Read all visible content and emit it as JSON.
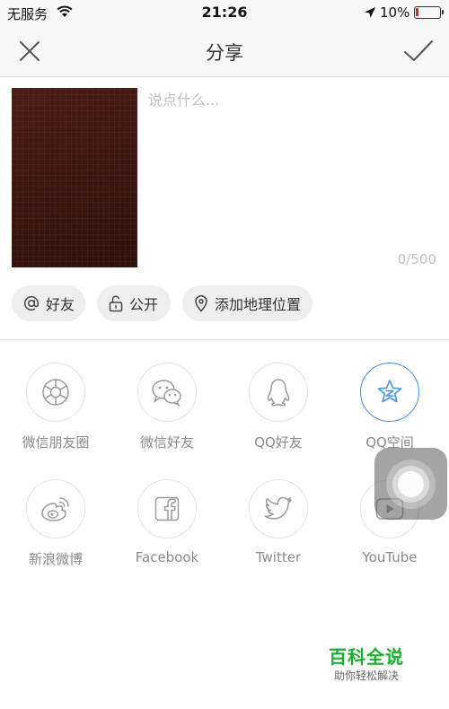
{
  "status_bar": {
    "carrier": "无服务",
    "time": "21:26",
    "battery_percent": "10%",
    "battery_level": 0.1,
    "battery_color": "#e02020"
  },
  "nav": {
    "title": "分享",
    "close_icon": "close-icon",
    "confirm_icon": "checkmark-icon"
  },
  "compose": {
    "placeholder": "说点什么...",
    "counter": "0/500"
  },
  "chips": [
    {
      "label": "好友",
      "icon": "at-icon"
    },
    {
      "label": "公开",
      "icon": "unlock-icon"
    },
    {
      "label": "添加地理位置",
      "icon": "location-pin-icon"
    }
  ],
  "share_targets": [
    {
      "label": "微信朋友圈",
      "icon": "wechat-moments-icon"
    },
    {
      "label": "微信好友",
      "icon": "wechat-icon"
    },
    {
      "label": "QQ好友",
      "icon": "qq-icon"
    },
    {
      "label": "QQ空间",
      "icon": "qzone-icon",
      "selected": true,
      "color": "#4a90e2"
    },
    {
      "label": "新浪微博",
      "icon": "weibo-icon"
    },
    {
      "label": "Facebook",
      "icon": "facebook-icon"
    },
    {
      "label": "Twitter",
      "icon": "twitter-icon"
    },
    {
      "label": "YouTube",
      "icon": "youtube-icon"
    }
  ],
  "watermark": {
    "title": "百科全说",
    "subtitle": "助你轻松解决"
  }
}
